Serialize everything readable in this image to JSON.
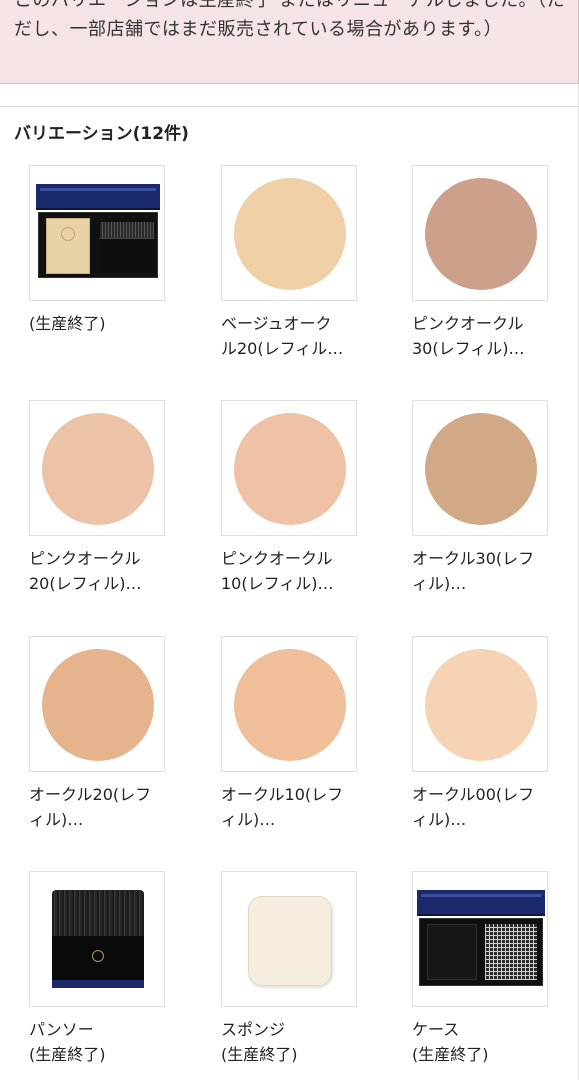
{
  "notice": {
    "text": "このバリエーションは生産終了 またはリニューアルしました。（ただし、一部店舗ではまだ販売されている場合があります。）"
  },
  "variations": {
    "title": "バリエーション(12件)",
    "items": [
      {
        "label_line1": "(生産終了)",
        "label_line2": "",
        "kind": "compact",
        "color": ""
      },
      {
        "label_line1": "ベージュオーク",
        "label_line2": "ル20(レフィル…",
        "kind": "swatch",
        "color": "#f0d0a6"
      },
      {
        "label_line1": "ピンクオークル",
        "label_line2": "30(レフィル)…",
        "kind": "swatch",
        "color": "#cca08a"
      },
      {
        "label_line1": "ピンクオークル",
        "label_line2": "20(レフィル)…",
        "kind": "swatch",
        "color": "#ecc3a6"
      },
      {
        "label_line1": "ピンクオークル",
        "label_line2": "10(レフィル)…",
        "kind": "swatch",
        "color": "#efc2a5"
      },
      {
        "label_line1": "オークル30(レフ",
        "label_line2": "ィル)…",
        "kind": "swatch",
        "color": "#d2a987"
      },
      {
        "label_line1": "オークル20(レフ",
        "label_line2": "ィル)…",
        "kind": "swatch",
        "color": "#e6b48c"
      },
      {
        "label_line1": "オークル10(レフ",
        "label_line2": "ィル)…",
        "kind": "swatch",
        "color": "#efbf99"
      },
      {
        "label_line1": "オークル00(レフ",
        "label_line2": "ィル)…",
        "kind": "swatch",
        "color": "#f5d3b4"
      },
      {
        "label_line1": "パンソー",
        "label_line2": "(生産終了)",
        "kind": "brush",
        "color": ""
      },
      {
        "label_line1": "スポンジ",
        "label_line2": "(生産終了)",
        "kind": "sponge",
        "color": ""
      },
      {
        "label_line1": "ケース",
        "label_line2": "(生産終了)",
        "kind": "case",
        "color": ""
      }
    ]
  }
}
